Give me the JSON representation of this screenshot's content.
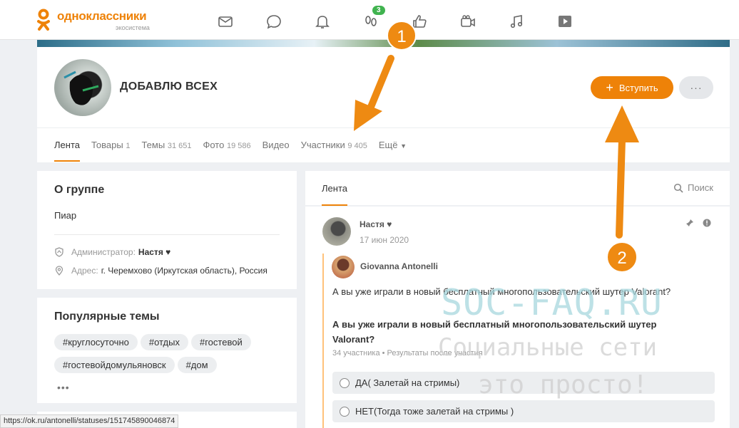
{
  "topbar": {
    "logo_name": "одноклассники",
    "logo_sub": "экосистема",
    "icons": [
      "mail-icon",
      "chat-icon",
      "bell-icon",
      "guests-icon",
      "like-icon",
      "video-chat-icon",
      "music-icon",
      "video-icon"
    ],
    "guests_badge": "3",
    "accent": "#ee8208"
  },
  "group": {
    "title": "ДОБАВЛЮ ВСЕХ",
    "join_label": "Вступить",
    "more_label": "···",
    "tabs": [
      {
        "label": "Лента",
        "count": ""
      },
      {
        "label": "Товары",
        "count": "1"
      },
      {
        "label": "Темы",
        "count": "31 651"
      },
      {
        "label": "Фото",
        "count": "19 586"
      },
      {
        "label": "Видео",
        "count": ""
      },
      {
        "label": "Участники",
        "count": "9 405"
      },
      {
        "label": "Ещё",
        "count": ""
      }
    ]
  },
  "about": {
    "title": "О группе",
    "desc": "Пиар",
    "admin_label": "Администратор:",
    "admin_value": "Настя ♥",
    "address_label": "Адрес:",
    "address_value": "г. Черемхово (Иркутская область), Россия"
  },
  "popular": {
    "title": "Популярные темы",
    "tags": [
      "#круглосуточно",
      "#отдых",
      "#гостевой",
      "#гостевойдомульяновск",
      "#дом"
    ],
    "more": "•••"
  },
  "feed": {
    "tab": "Лента",
    "search_label": "Поиск",
    "post": {
      "author": "Настя ♥",
      "date": "17 июн 2020",
      "repost_author": "Giovanna Antonelli",
      "text": "А вы уже играли в новый бесплатный многопользовательский шутер Valorant?",
      "question": "А вы уже играли в новый бесплатный многопользовательский шутер Valorant?",
      "meta": "34 участника  •  Результаты после участия",
      "options": [
        "ДА( Залетай на стримы)",
        "НЕТ(Тогда тоже залетай на стримы )"
      ]
    }
  },
  "watermark": {
    "line1": "SOC-FAQ.RU",
    "line2": "Социальные сети",
    "line3": "это просто!"
  },
  "annotations": {
    "marker1": "1",
    "marker2": "2",
    "color": "#ee8a12"
  },
  "statusbar": {
    "url": "https://ok.ru/antonelli/statuses/151745890046874"
  }
}
